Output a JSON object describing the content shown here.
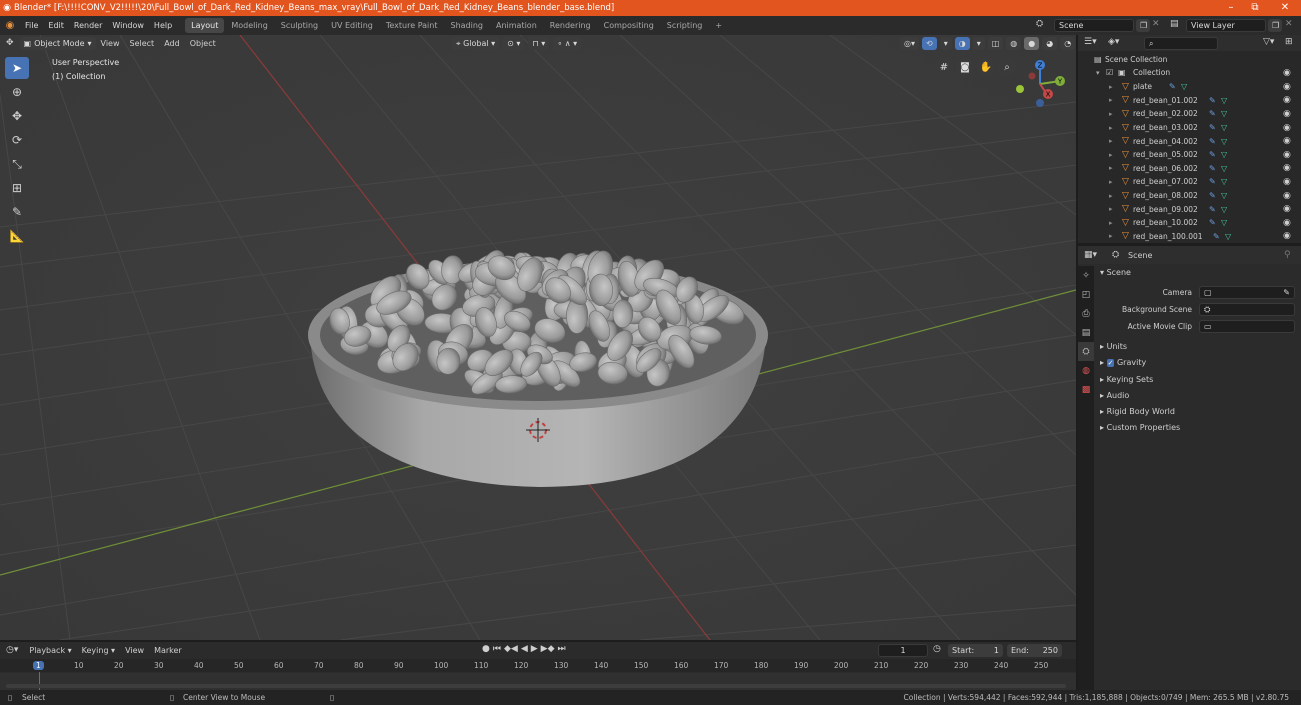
{
  "titlebar": {
    "title": "Blender* [F:\\!!!!CONV_V2!!!!!\\20\\Full_Bowl_of_Dark_Red_Kidney_Beans_max_vray\\Full_Bowl_of_Dark_Red_Kidney_Beans_blender_base.blend]",
    "minimize": "–",
    "restore": "⧉",
    "close": "✕"
  },
  "menu": [
    "File",
    "Edit",
    "Render",
    "Window",
    "Help"
  ],
  "workspaces": [
    "Layout",
    "Modeling",
    "Sculpting",
    "UV Editing",
    "Texture Paint",
    "Shading",
    "Animation",
    "Rendering",
    "Compositing",
    "Scripting"
  ],
  "add_workspace": "+",
  "scene_selector": "Scene",
  "view_layer": "View Layer",
  "viewport_header": {
    "mode": "Object Mode",
    "menus": [
      "View",
      "Select",
      "Add",
      "Object"
    ],
    "orientation": "Global"
  },
  "viewport_overlay": {
    "perspective": "User Perspective",
    "collection": "(1) Collection"
  },
  "gizmo": {
    "x": "X",
    "y": "Y",
    "z": "Z"
  },
  "outliner": {
    "search_placeholder": "",
    "root": "Scene Collection",
    "collection": "Collection",
    "items": [
      "plate",
      "red_bean_01.002",
      "red_bean_02.002",
      "red_bean_03.002",
      "red_bean_04.002",
      "red_bean_05.002",
      "red_bean_06.002",
      "red_bean_07.002",
      "red_bean_08.002",
      "red_bean_09.002",
      "red_bean_10.002",
      "red_bean_100.001"
    ]
  },
  "properties": {
    "context": "Scene",
    "panel_title": "Scene",
    "camera_label": "Camera",
    "background_label": "Background Scene",
    "movie_clip_label": "Active Movie Clip",
    "sections": [
      "Units",
      "Gravity",
      "Keying Sets",
      "Audio",
      "Rigid Body World",
      "Custom Properties"
    ]
  },
  "timeline": {
    "menus": [
      "Playback",
      "Keying",
      "View",
      "Marker"
    ],
    "current_frame": "1",
    "start_label": "Start:",
    "start": "1",
    "end_label": "End:",
    "end": "250",
    "ruler": [
      "1",
      "10",
      "20",
      "30",
      "40",
      "50",
      "60",
      "70",
      "80",
      "90",
      "100",
      "110",
      "120",
      "130",
      "140",
      "150",
      "160",
      "170",
      "180",
      "190",
      "200",
      "210",
      "220",
      "230",
      "240",
      "250"
    ]
  },
  "statusbar": {
    "select": "Select",
    "center_view": "Center View to Mouse",
    "stats": "Collection | Verts:594,442 | Faces:592,944 | Tris:1,185,888 | Objects:0/749 | Mem: 265.5 MB | v2.80.75"
  },
  "colors": {
    "titlebar": "#e2551f",
    "active_tool": "#4772b3",
    "x_axis": "#c34848",
    "y_axis": "#7fae3a",
    "z_axis": "#3f7fd6",
    "mesh_icon": "#e8923d"
  },
  "icons": [
    "blender-logo-icon",
    "cursor-icon",
    "move-icon",
    "rotate-icon",
    "scale-icon",
    "transform-icon",
    "annotate-icon",
    "measure-icon",
    "eye-icon",
    "camera-icon",
    "hand-icon",
    "zoom-icon",
    "grid-icon"
  ]
}
